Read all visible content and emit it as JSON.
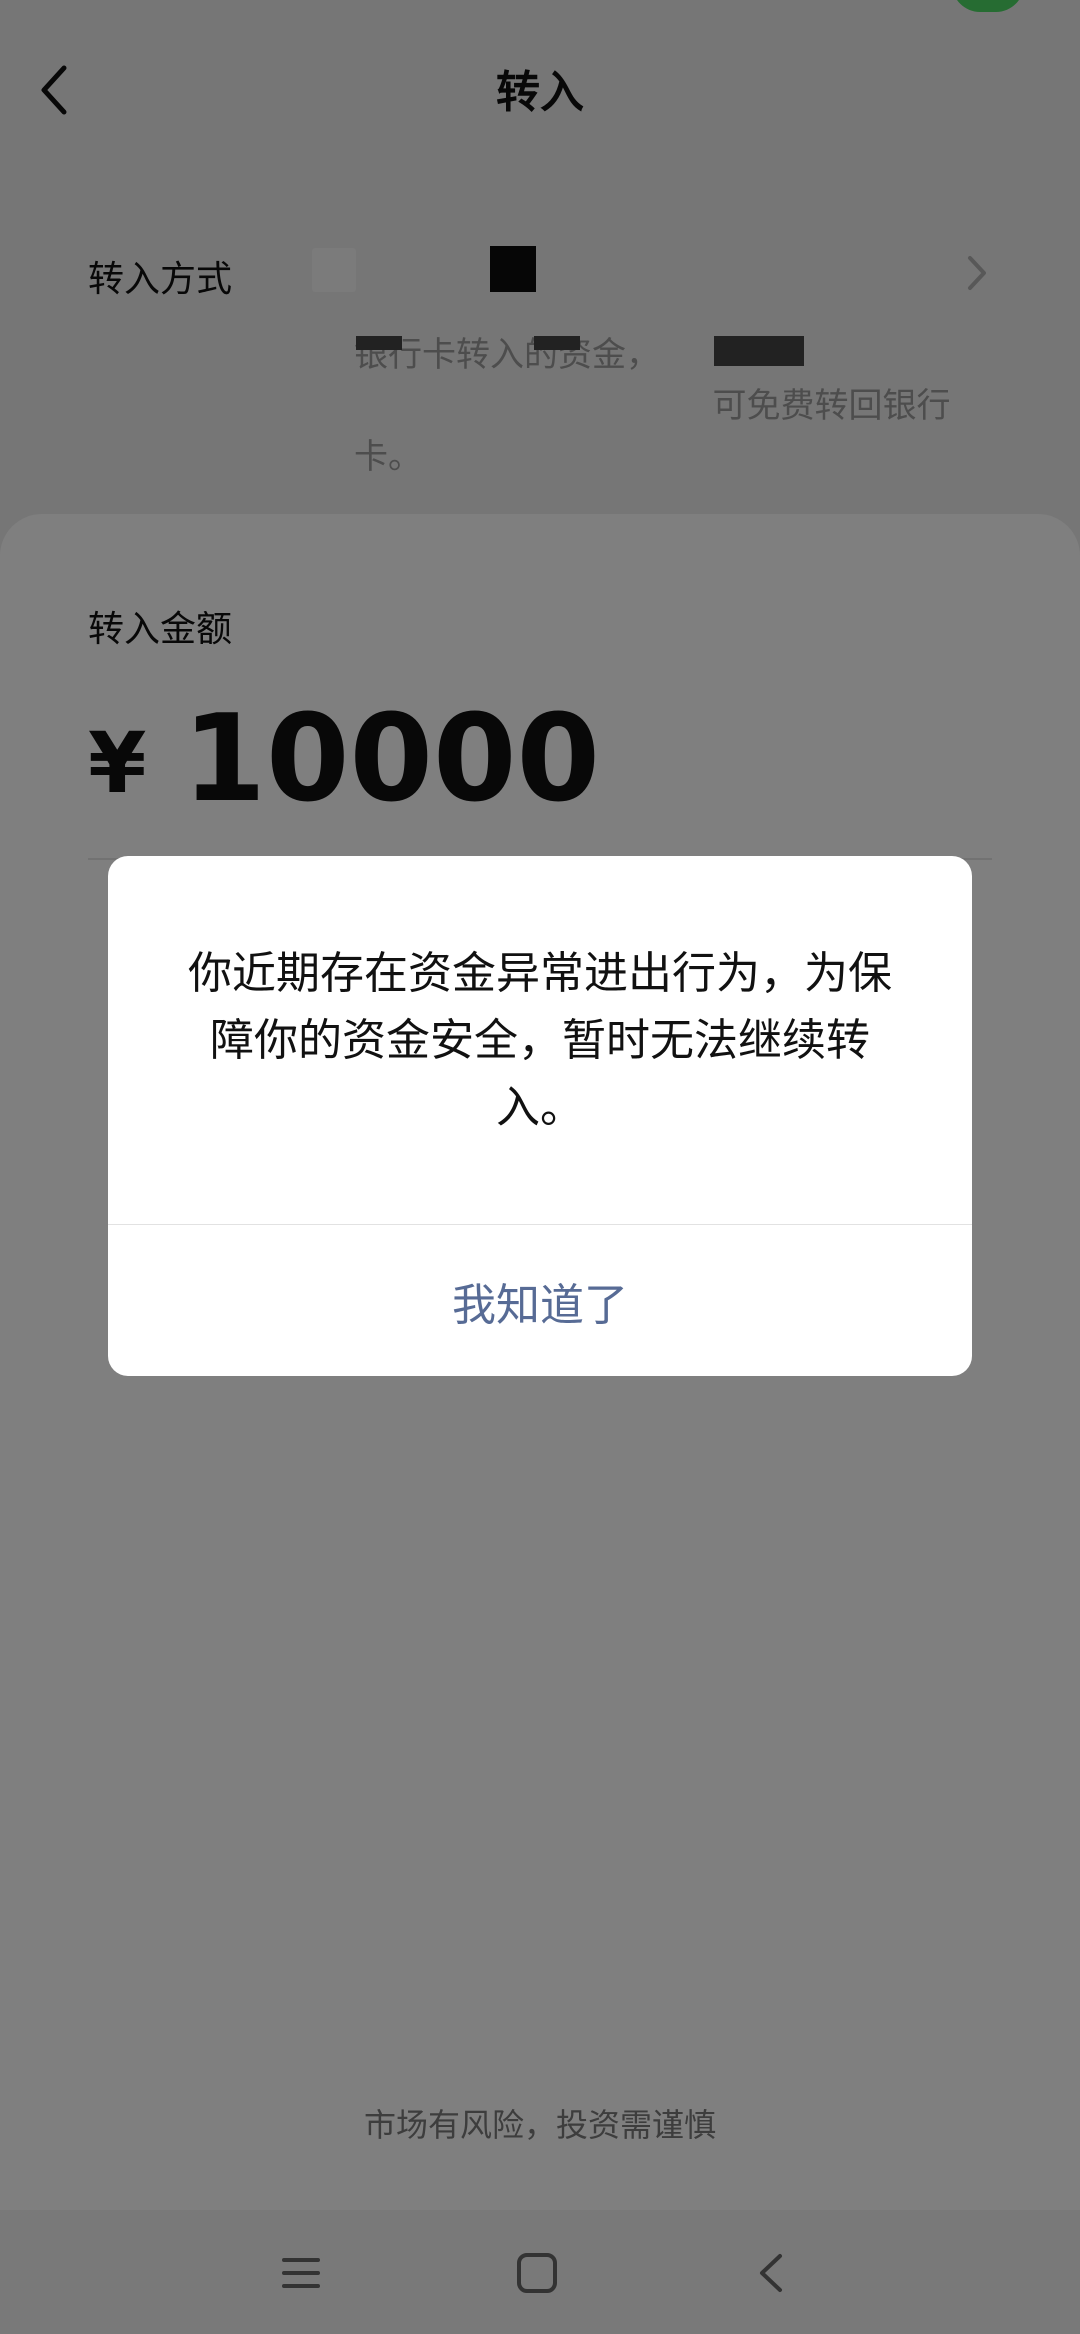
{
  "header": {
    "title": "转入",
    "back_icon": "chevron-left-icon"
  },
  "transfer_method": {
    "label": "转入方式",
    "note": "银行卡转入的资金， 　 　 　 　 　 　 　 　  可免费转回银行卡。",
    "arrow_icon": "chevron-right-icon"
  },
  "amount": {
    "label": "转入金额",
    "currency": "¥",
    "value": "10000"
  },
  "footer": {
    "risk_note": "市场有风险，投资需谨慎"
  },
  "dialog": {
    "message": "你近期存在资金异常进出行为，为保障你的资金安全，暂时无法继续转入。",
    "button_label": "我知道了",
    "button_color": "#576b95"
  },
  "system_nav": {
    "icons": [
      "menu-icon",
      "home-icon",
      "back-icon"
    ]
  },
  "colors": {
    "accent_green": "#4cd964",
    "overlay": "rgba(0,0,0,0.5)"
  }
}
